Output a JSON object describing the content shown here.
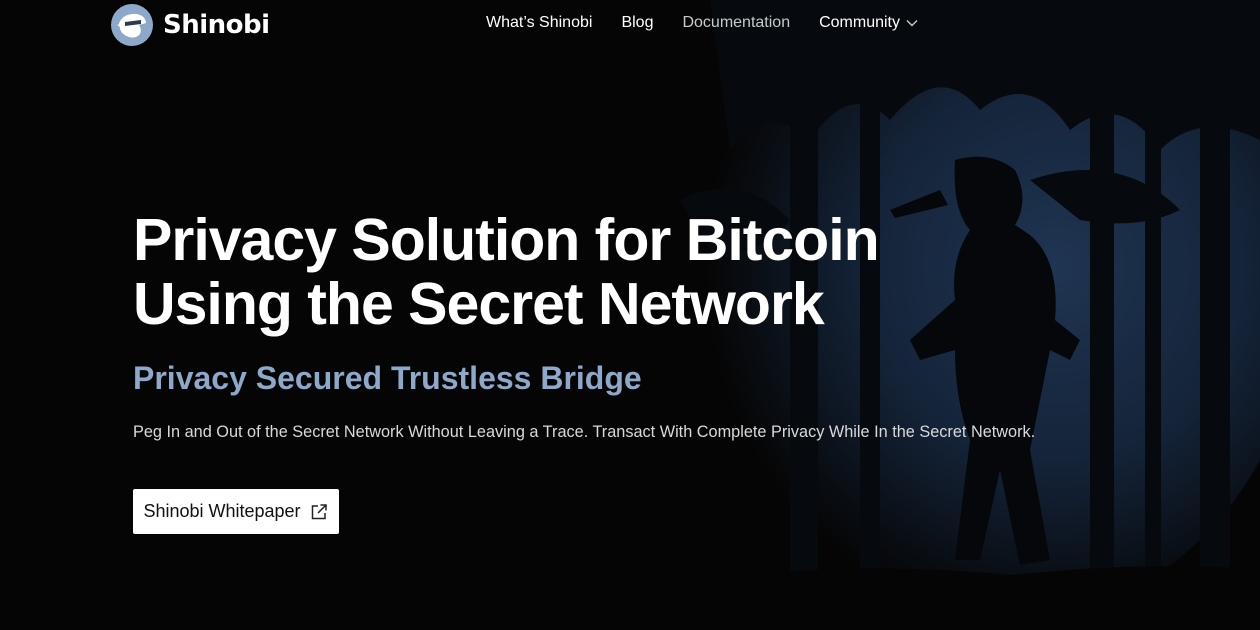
{
  "brand": {
    "name": "Shinobi",
    "logo_icon": "ninja-head-icon",
    "accent": "#8ea8c9",
    "background": "#050505"
  },
  "nav": {
    "items": [
      {
        "label": "What’s Shinobi"
      },
      {
        "label": "Blog"
      },
      {
        "label": "Documentation"
      },
      {
        "label": "Community",
        "icon": "chevron-down-icon"
      }
    ]
  },
  "hero": {
    "title_line1": "Privacy Solution for Bitcoin",
    "title_line2": "Using the Secret Network",
    "subtitle": "Privacy Secured Trustless Bridge",
    "description": "Peg In and Out of the Secret Network Without Leaving a Trace. Transact With Complete Privacy While In the Secret Network.",
    "cta_label": "Shinobi Whitepaper",
    "cta_icon": "external-link-icon"
  }
}
